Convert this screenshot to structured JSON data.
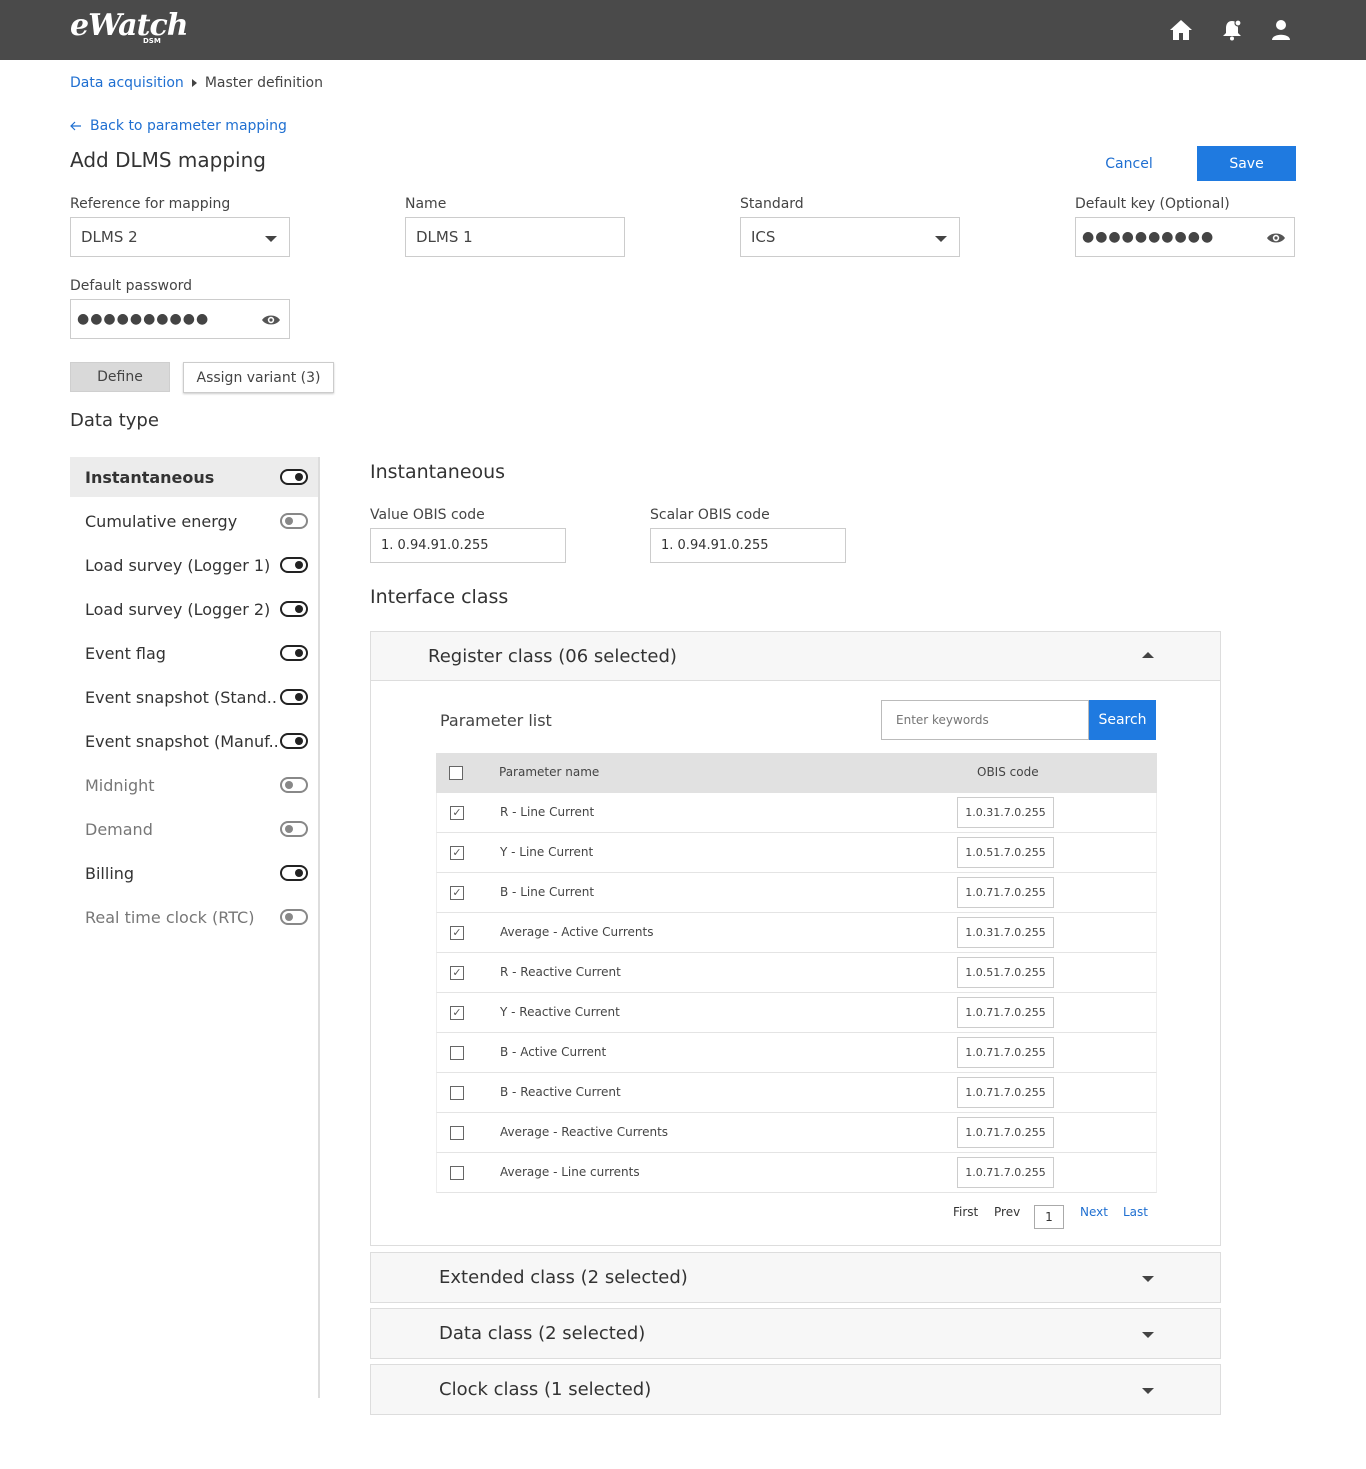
{
  "app": {
    "logo": "eWatch",
    "logo_sub": "DSM"
  },
  "topbar_icons": [
    "home-icon",
    "notification-bell-icon",
    "user-icon"
  ],
  "breadcrumb": {
    "link": "Data acquisition",
    "current": "Master definition"
  },
  "back_link": "Back to parameter mapping",
  "page_title": "Add DLMS mapping",
  "actions": {
    "cancel": "Cancel",
    "save": "Save"
  },
  "form": {
    "reference": {
      "label": "Reference for mapping",
      "value": "DLMS 2"
    },
    "name": {
      "label": "Name",
      "value": "DLMS 1"
    },
    "standard": {
      "label": "Standard",
      "value": "ICS"
    },
    "default_key": {
      "label": "Default key (Optional)",
      "value": "●●●●●●●●●●"
    },
    "default_password": {
      "label": "Default password",
      "value": "●●●●●●●●●●"
    }
  },
  "tabs": {
    "define": "Define",
    "assign": "Assign variant (3)"
  },
  "data_type": {
    "heading": "Data type",
    "items": [
      {
        "label": "Instantaneous",
        "on": true,
        "active": true
      },
      {
        "label": "Cumulative energy",
        "on": false
      },
      {
        "label": "Load survey (Logger 1)",
        "on": true
      },
      {
        "label": "Load survey (Logger 2)",
        "on": true
      },
      {
        "label": "Event flag",
        "on": true
      },
      {
        "label": "Event snapshot (Stand..",
        "on": true
      },
      {
        "label": "Event snapshot (Manuf..",
        "on": true
      },
      {
        "label": "Midnight",
        "on": false
      },
      {
        "label": "Demand",
        "on": false
      },
      {
        "label": "Billing",
        "on": true
      },
      {
        "label": "Real time clock (RTC)",
        "on": false
      }
    ]
  },
  "detail": {
    "heading": "Instantaneous",
    "value_obis": {
      "label": "Value OBIS code",
      "value": "1. 0.94.91.0.255"
    },
    "scalar_obis": {
      "label": "Scalar OBIS code",
      "value": "1. 0.94.91.0.255"
    },
    "interface_heading": "Interface class"
  },
  "register_class": {
    "title": "Register class (06 selected)",
    "param_list_title": "Parameter list",
    "search_placeholder": "Enter keywords",
    "search_button": "Search",
    "col_name": "Parameter name",
    "col_obis": "OBIS code",
    "rows": [
      {
        "name": "R - Line Current",
        "obis": "1.0.31.7.0.255",
        "checked": true
      },
      {
        "name": "Y - Line Current",
        "obis": "1.0.51.7.0.255",
        "checked": true
      },
      {
        "name": "B - Line Current",
        "obis": "1.0.71.7.0.255",
        "checked": true
      },
      {
        "name": "Average - Active Currents",
        "obis": "1.0.31.7.0.255",
        "checked": true
      },
      {
        "name": "R - Reactive Current",
        "obis": "1.0.51.7.0.255",
        "checked": true
      },
      {
        "name": "Y - Reactive Current",
        "obis": "1.0.71.7.0.255",
        "checked": true
      },
      {
        "name": "B - Active Current",
        "obis": "1.0.71.7.0.255",
        "checked": false
      },
      {
        "name": "B - Reactive Current",
        "obis": "1.0.71.7.0.255",
        "checked": false
      },
      {
        "name": "Average - Reactive Currents",
        "obis": "1.0.71.7.0.255",
        "checked": false
      },
      {
        "name": "Average - Line currents",
        "obis": "1.0.71.7.0.255",
        "checked": false
      }
    ],
    "pager": {
      "first": "First",
      "prev": "Prev",
      "page": "1",
      "next": "Next",
      "last": "Last"
    }
  },
  "other_classes": [
    "Extended class (2 selected)",
    "Data class (2 selected)",
    "Clock class (1 selected)"
  ],
  "colors": {
    "accent": "#1f7ae0",
    "topbar": "#4a4a4a"
  }
}
